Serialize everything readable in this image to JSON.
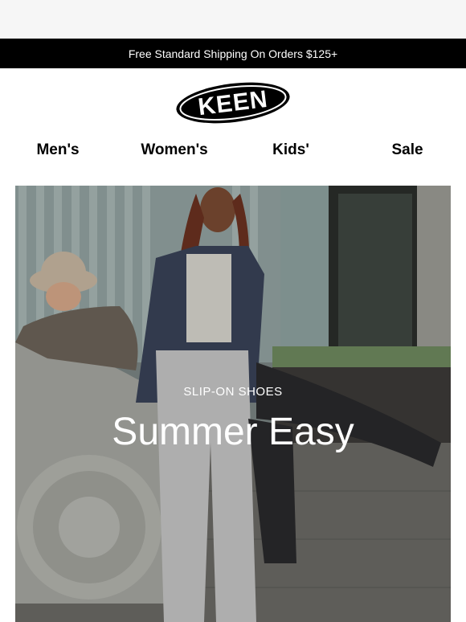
{
  "promo": {
    "text": "Free Standard Shipping On Orders $125+"
  },
  "brand": {
    "logo_text": "KEEN"
  },
  "nav": {
    "items": [
      {
        "label": "Men's"
      },
      {
        "label": "Women's"
      },
      {
        "label": "Kids'"
      },
      {
        "label": "Sale"
      }
    ]
  },
  "hero": {
    "eyebrow": "SLIP-ON SHOES",
    "title": "Summer Easy"
  },
  "colors": {
    "promo_bg": "#000000",
    "promo_text": "#ffffff",
    "nav_text": "#000000"
  }
}
